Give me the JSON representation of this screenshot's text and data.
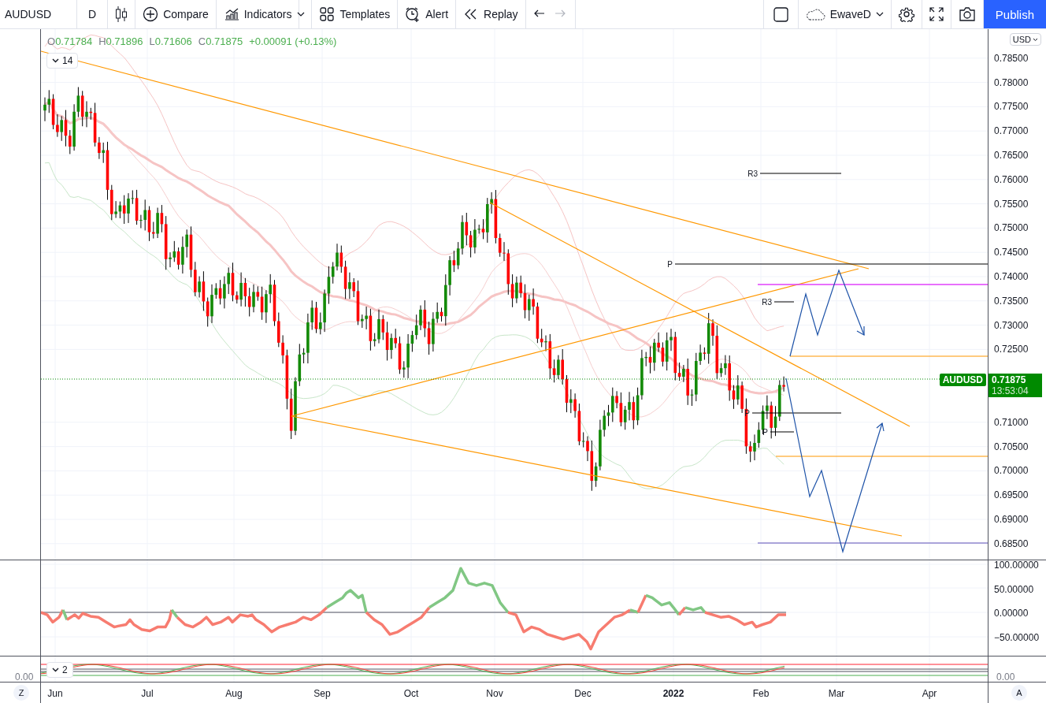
{
  "toolbar": {
    "symbol": "AUDUSD",
    "interval": "D",
    "buttons": [
      {
        "kind": "compare",
        "label": "Compare"
      },
      {
        "kind": "indicators",
        "label": "Indicators"
      },
      {
        "kind": "templates",
        "label": "Templates"
      },
      {
        "kind": "alert",
        "label": "Alert"
      },
      {
        "kind": "replay",
        "label": "Replay"
      }
    ],
    "undo_disabled": false,
    "redo_disabled": true,
    "layout_name": "EwaveD",
    "publish": "Publish"
  },
  "legend": {
    "values": [
      {
        "label": "O",
        "value": "0.71784"
      },
      {
        "label": "H",
        "value": "0.71896"
      },
      {
        "label": "L",
        "value": "0.71606"
      },
      {
        "label": "C",
        "value": "0.71875"
      }
    ],
    "change": "+0.00091 (+0.13%)",
    "indicator_count": "14"
  },
  "price_axis": {
    "currency": "USD",
    "labels": [
      "0.78500",
      "0.78000",
      "0.77500",
      "0.77000",
      "0.76500",
      "0.76000",
      "0.75500",
      "0.75000",
      "0.74500",
      "0.74000",
      "0.73500",
      "0.73000",
      "0.72500",
      "0.71000",
      "0.70500",
      "0.70000",
      "0.69500",
      "0.69000",
      "0.68500"
    ],
    "last_price": {
      "symbol": "AUDUSD",
      "price": "0.71875",
      "countdown": "13:53:04"
    }
  },
  "annotations": [
    {
      "text": "R3"
    },
    {
      "text": "P"
    },
    {
      "text": "R3"
    },
    {
      "text": "P"
    },
    {
      "text": "P"
    }
  ],
  "oscillator": {
    "axis_labels": [
      "100.00000",
      "50.00000",
      "0.00000",
      "−50.00000"
    ]
  },
  "pane_3": {
    "indicator_count": "2",
    "left_label": "0.00",
    "right_label": "0.00"
  },
  "time_axis": {
    "labels": [
      {
        "text": "Jun",
        "bold": false
      },
      {
        "text": "Jul",
        "bold": false
      },
      {
        "text": "Aug",
        "bold": false
      },
      {
        "text": "Sep",
        "bold": false
      },
      {
        "text": "Oct",
        "bold": false
      },
      {
        "text": "Nov",
        "bold": false
      },
      {
        "text": "Dec",
        "bold": false
      },
      {
        "text": "2022",
        "bold": true
      },
      {
        "text": "Feb",
        "bold": false
      },
      {
        "text": "Mar",
        "bold": false
      },
      {
        "text": "Apr",
        "bold": false
      }
    ]
  },
  "corner_buttons": [
    "Z",
    "A"
  ]
}
